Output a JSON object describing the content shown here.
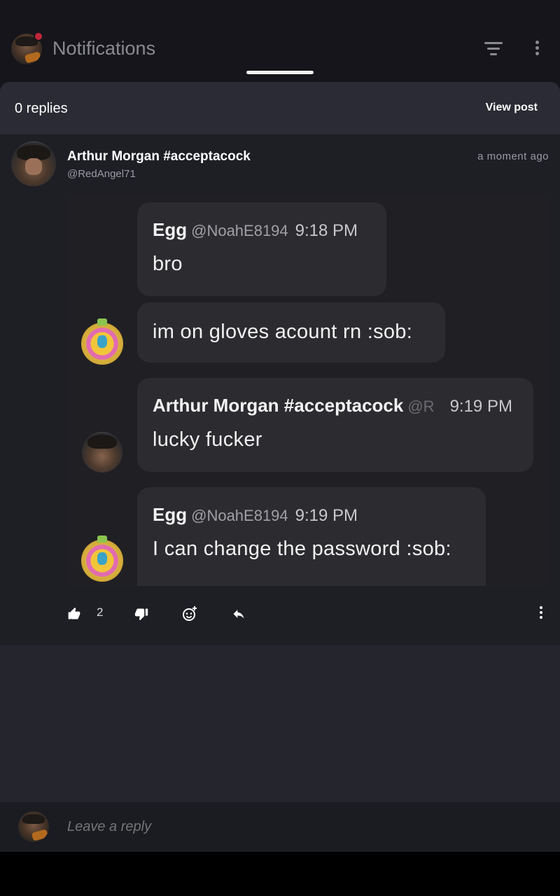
{
  "header": {
    "title": "Notifications",
    "filter_icon": "filter-icon",
    "more_icon": "more-vert-icon"
  },
  "sheet": {
    "replies_label": "0 replies",
    "view_post_label": "View post"
  },
  "post": {
    "author_name": "Arthur Morgan #acceptacock",
    "author_handle": "@RedAngel71",
    "timestamp": "a moment ago",
    "image_messages": [
      {
        "name": "Egg",
        "handle": "@NoahE8194",
        "time": "9:18 PM",
        "text": "bro"
      },
      {
        "text": "im on gloves acount rn :sob:"
      },
      {
        "name": "Arthur Morgan #acceptacock",
        "handle": "@R",
        "time": "9:19 PM",
        "text": "lucky fucker"
      },
      {
        "name": "Egg",
        "handle": "@NoahE8194",
        "time": "9:19 PM",
        "text": "I can change the password :sob:"
      }
    ],
    "actions": {
      "like_count": "2",
      "like_icon": "thumbs-up-icon",
      "dislike_icon": "thumbs-down-icon",
      "react_icon": "add-reaction-icon",
      "reply_icon": "reply-icon",
      "more_icon": "more-vert-icon"
    }
  },
  "reply_bar": {
    "placeholder": "Leave a reply"
  },
  "colors": {
    "sheet_bg": "#24252d",
    "post_bg": "#1e1f25",
    "notification_dot": "#c0263a"
  }
}
